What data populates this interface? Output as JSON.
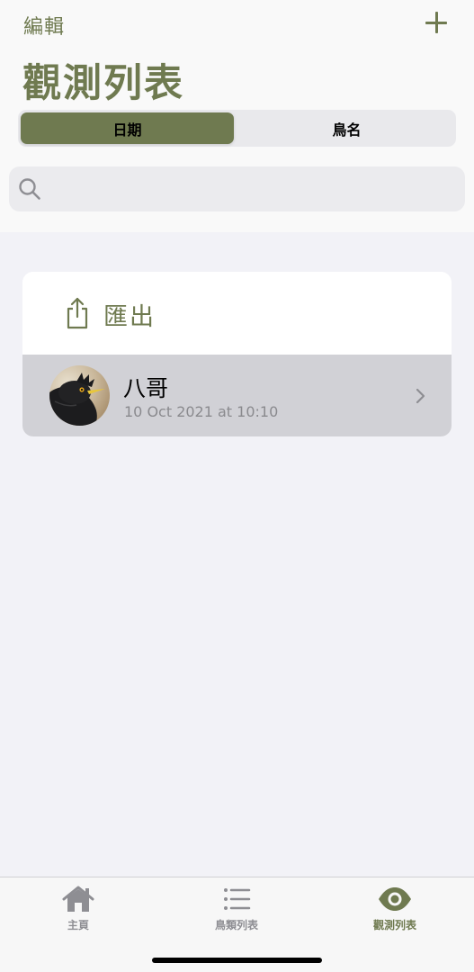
{
  "header": {
    "edit_label": "編輯",
    "title": "觀測列表"
  },
  "segmented": {
    "options": [
      "日期",
      "鳥名"
    ],
    "selected": "日期"
  },
  "search": {
    "placeholder": ""
  },
  "list": {
    "export_label": "匯出",
    "items": [
      {
        "name": "八哥",
        "date": "10 Oct 2021 at 10:10"
      }
    ]
  },
  "tab_bar": {
    "tabs": [
      {
        "label": "主頁",
        "icon": "house-icon"
      },
      {
        "label": "鳥類列表",
        "icon": "list-icon"
      },
      {
        "label": "觀測列表",
        "icon": "eye-icon"
      }
    ],
    "active": "觀測列表"
  },
  "colors": {
    "accent": "#6f7a50",
    "background": "#f2f2f7",
    "selected_row": "#d1d1d6"
  }
}
